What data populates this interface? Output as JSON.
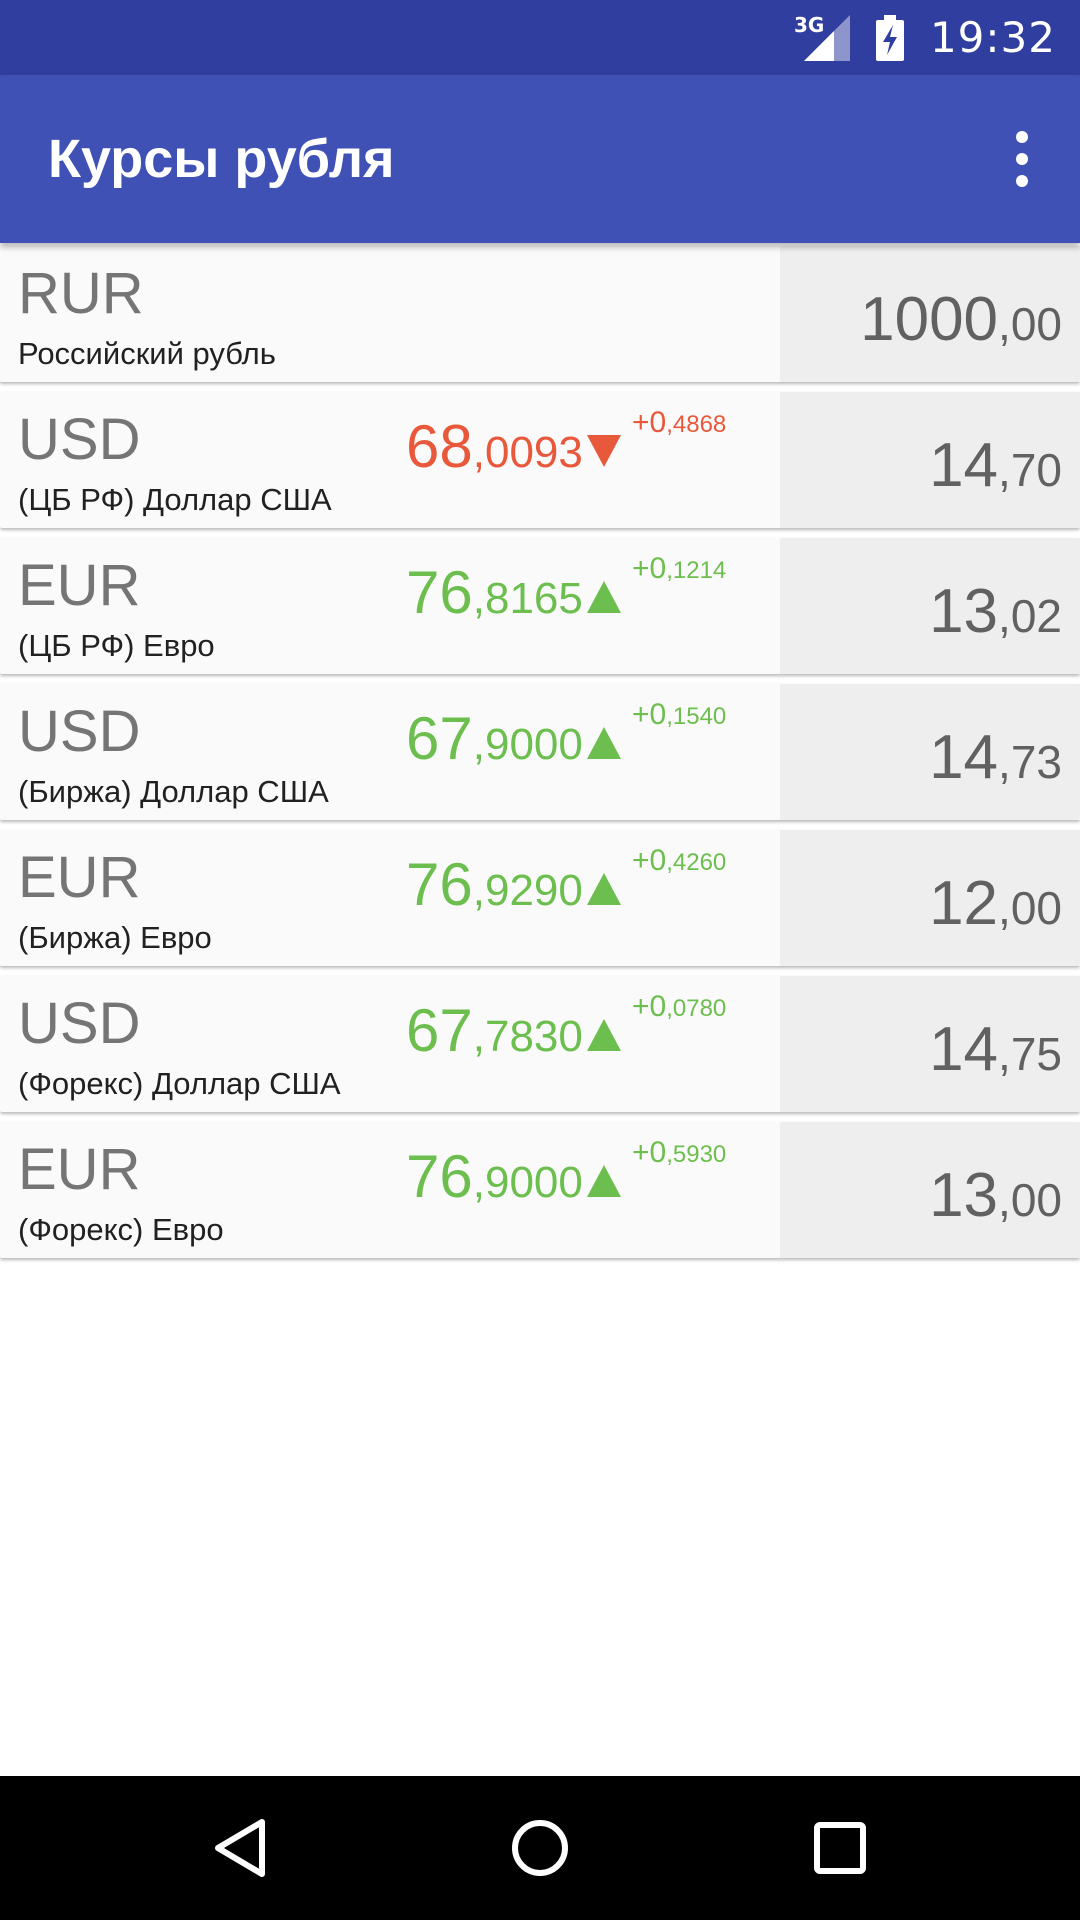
{
  "status_bar": {
    "network": "3G",
    "time": "19:32"
  },
  "app_bar": {
    "title": "Курсы рубля"
  },
  "icons": {
    "signal": "signal-icon",
    "battery": "battery-charging-icon",
    "overflow": "more-vert-icon",
    "back": "back-icon",
    "home": "home-icon",
    "recents": "recents-icon",
    "up": "triangle-up-icon",
    "down": "triangle-down-icon"
  },
  "colors": {
    "status_bar": "#303f9f",
    "app_bar": "#3f51b5",
    "rate_up": "#6cbf4e",
    "rate_down": "#e8593c"
  },
  "rows": [
    {
      "code": "RUR",
      "name": "Российский рубль",
      "amount_int": "1000",
      "amount_frac": ",00"
    },
    {
      "code": "USD",
      "name": "(ЦБ РФ) Доллар США",
      "rate_int": "68",
      "rate_frac": ",0093",
      "direction": "down",
      "change_int": "+0",
      "change_frac": ",4868",
      "amount_int": "14",
      "amount_frac": ",70"
    },
    {
      "code": "EUR",
      "name": "(ЦБ РФ) Евро",
      "rate_int": "76",
      "rate_frac": ",8165",
      "direction": "up",
      "change_int": "+0",
      "change_frac": ",1214",
      "amount_int": "13",
      "amount_frac": ",02"
    },
    {
      "code": "USD",
      "name": "(Биржа) Доллар США",
      "rate_int": "67",
      "rate_frac": ",9000",
      "direction": "up",
      "change_int": "+0",
      "change_frac": ",1540",
      "amount_int": "14",
      "amount_frac": ",73"
    },
    {
      "code": "EUR",
      "name": "(Биржа) Евро",
      "rate_int": "76",
      "rate_frac": ",9290",
      "direction": "up",
      "change_int": "+0",
      "change_frac": ",4260",
      "amount_int": "12",
      "amount_frac": ",00"
    },
    {
      "code": "USD",
      "name": "(Форекс) Доллар США",
      "rate_int": "67",
      "rate_frac": ",7830",
      "direction": "up",
      "change_int": "+0",
      "change_frac": ",0780",
      "amount_int": "14",
      "amount_frac": ",75"
    },
    {
      "code": "EUR",
      "name": "(Форекс) Евро",
      "rate_int": "76",
      "rate_frac": ",9000",
      "direction": "up",
      "change_int": "+0",
      "change_frac": ",5930",
      "amount_int": "13",
      "amount_frac": ",00"
    }
  ]
}
